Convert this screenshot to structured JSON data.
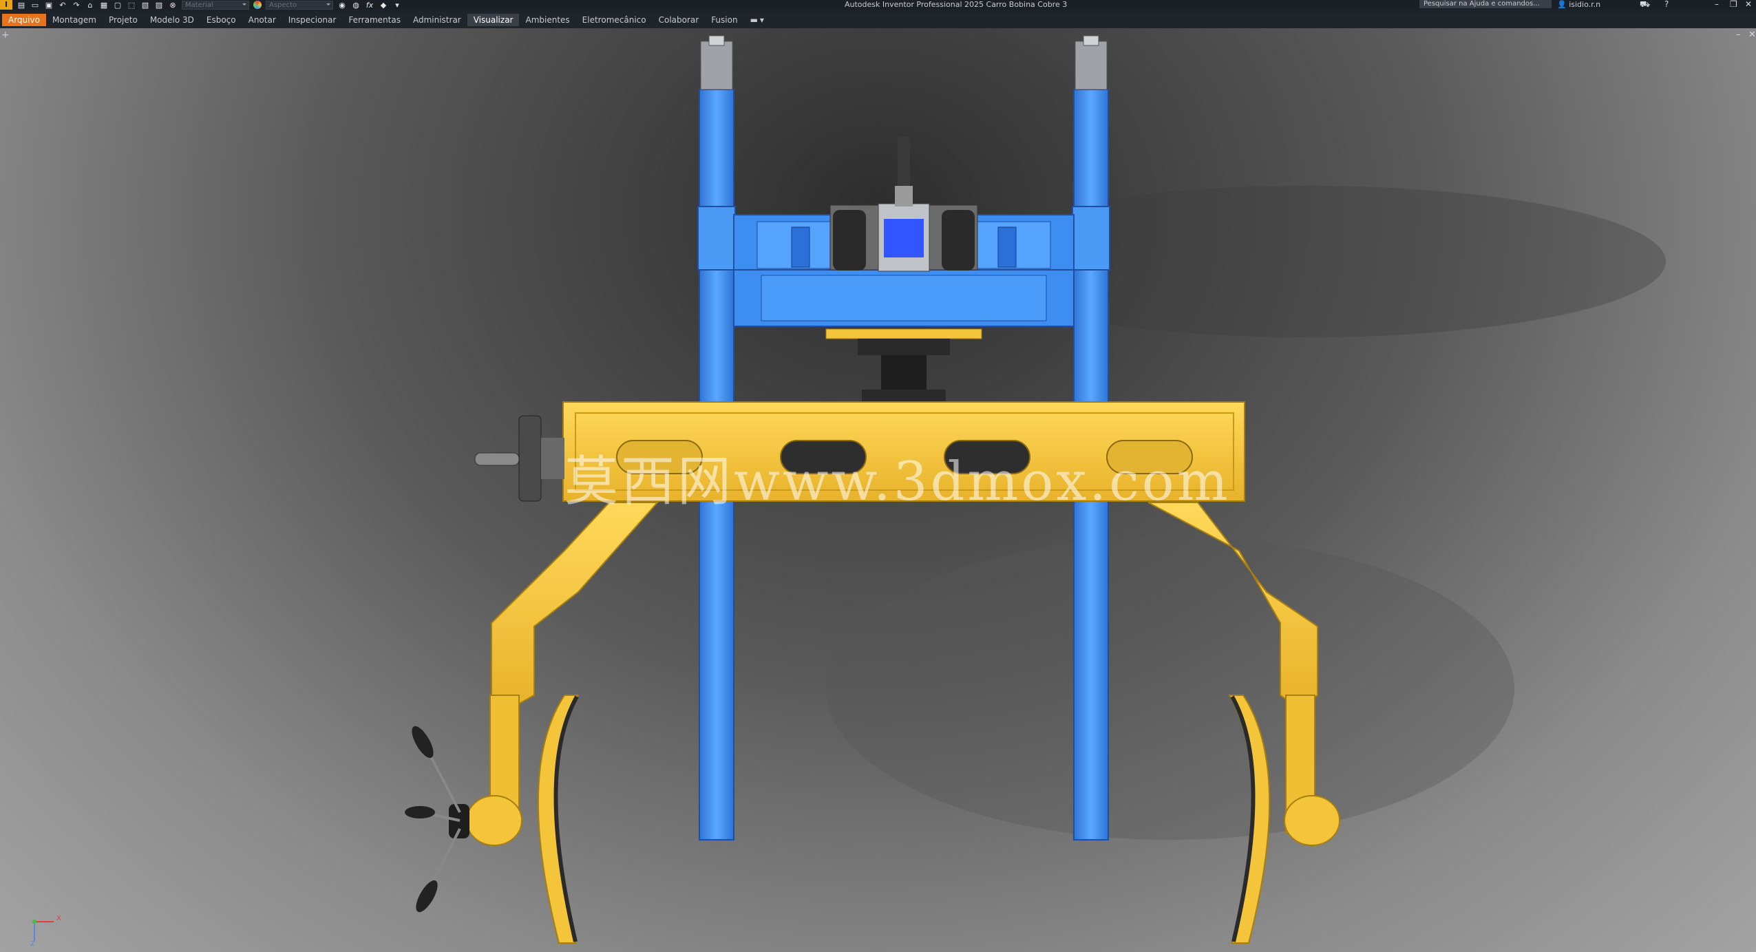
{
  "titlebar": {
    "app_logo": "I",
    "material_placeholder": "Material",
    "appearance_placeholder": "Aspecto",
    "fx_label": "fx",
    "window_title": "Autodesk Inventor Professional 2025    Carro Bobina Cobre 3",
    "search_placeholder": "Pesquisar na Ajuda e comandos...",
    "user_name": "isidio.r.n"
  },
  "ribbon": {
    "tabs": [
      {
        "label": "Arquivo"
      },
      {
        "label": "Montagem"
      },
      {
        "label": "Projeto"
      },
      {
        "label": "Modelo 3D"
      },
      {
        "label": "Esboço"
      },
      {
        "label": "Anotar"
      },
      {
        "label": "Inspecionar"
      },
      {
        "label": "Ferramentas"
      },
      {
        "label": "Administrar"
      },
      {
        "label": "Visualizar"
      },
      {
        "label": "Ambientes"
      },
      {
        "label": "Eletromecânico"
      },
      {
        "label": "Colaborar"
      },
      {
        "label": "Fusion"
      }
    ],
    "active_tab": "Visualizar"
  },
  "viewport": {
    "watermark": "莫西网www.3dmox.com",
    "triad": {
      "x_label": "X",
      "z_label": "Z"
    },
    "colors": {
      "frame_blue": "#3d8ef0",
      "yoke_yellow": "#f4c53a",
      "dark_part": "#2a2a2a"
    }
  }
}
